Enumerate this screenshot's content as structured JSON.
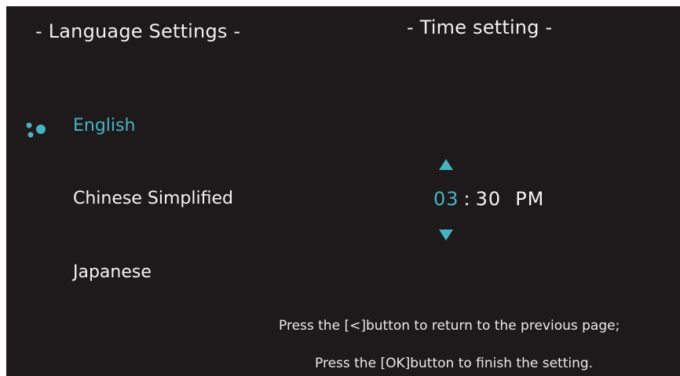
{
  "language_settings": {
    "title": "- Language Settings -",
    "items": [
      {
        "label": "English",
        "selected": true
      },
      {
        "label": "Chinese Simplified",
        "selected": false
      },
      {
        "label": "Japanese",
        "selected": false
      }
    ],
    "selection_icon": "dots-cursor-icon"
  },
  "time_setting": {
    "title": "- Time setting -",
    "hour": "03",
    "separator": ":",
    "minute": "30",
    "ampm": "PM",
    "up_icon": "triangle-up-icon",
    "down_icon": "triangle-down-icon"
  },
  "hints": {
    "back": "Press the [<]button to return to the previous page;",
    "finish": "Press the [OK]button to finish the setting."
  },
  "colors": {
    "background": "#1e191b",
    "accent": "#46b4c0",
    "text": "#f2f2f2"
  }
}
